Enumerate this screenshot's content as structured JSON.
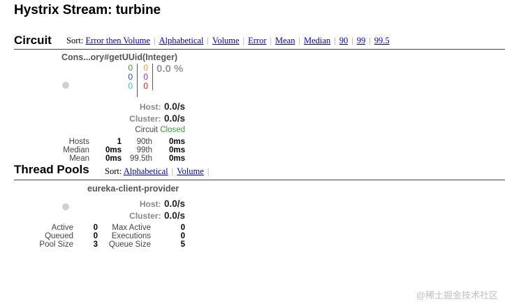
{
  "page": {
    "title": "Hystrix Stream: turbine"
  },
  "circuit": {
    "section_title": "Circuit",
    "sort_label": "Sort:",
    "sort_options": [
      "Error then Volume",
      "Alphabetical",
      "Volume",
      "Error",
      "Mean",
      "Median",
      "90",
      "99",
      "99.5"
    ],
    "card": {
      "name": "Cons...ory#getUUid(Integer)",
      "counts_left": [
        "0",
        "0",
        "0"
      ],
      "counts_right": [
        "0",
        "0",
        "0"
      ],
      "error_pct": "0.0 %",
      "host_label": "Host:",
      "host_rate": "0.0/s",
      "cluster_label": "Cluster:",
      "cluster_rate": "0.0/s",
      "circuit_label": "Circuit",
      "circuit_status": "Closed",
      "stats": {
        "labels": [
          "Hosts",
          "Median",
          "Mean"
        ],
        "values": [
          "1",
          "0ms",
          "0ms"
        ],
        "pct_labels": [
          "90th",
          "99th",
          "99.5th"
        ],
        "pct_values": [
          "0ms",
          "0ms",
          "0ms"
        ]
      }
    }
  },
  "thread_pools": {
    "section_title": "Thread Pools",
    "sort_label": "Sort:",
    "sort_options": [
      "Alphabetical",
      "Volume"
    ],
    "card": {
      "name": "eureka-client-provider",
      "host_label": "Host:",
      "host_rate": "0.0/s",
      "cluster_label": "Cluster:",
      "cluster_rate": "0.0/s",
      "stats": {
        "labels": [
          "Active",
          "Queued",
          "Pool Size"
        ],
        "values": [
          "0",
          "0",
          "3"
        ],
        "labels2": [
          "Max Active",
          "Executions",
          "Queue Size"
        ],
        "values2": [
          "0",
          "0",
          "5"
        ]
      }
    }
  },
  "watermark": "@稀土掘金技术社区",
  "colors": {
    "link": "#0000cc",
    "green": "#3c9a3c",
    "blue": "#2a49b8",
    "teal": "#27c4c4",
    "orange": "#e8a21c",
    "purple": "#8a3ab0",
    "red": "#cc2222",
    "status_closed": "#2e9e2e"
  }
}
